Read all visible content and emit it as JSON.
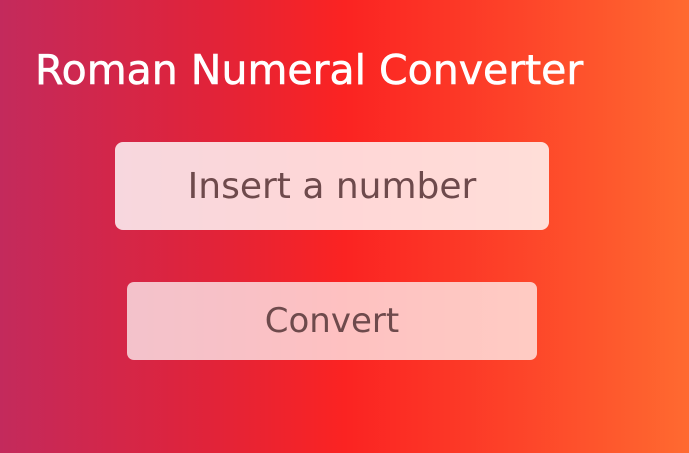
{
  "app": {
    "title": "Roman Numeral Converter"
  },
  "form": {
    "number_input": {
      "placeholder": "Insert a number",
      "value": ""
    },
    "convert_button_label": "Convert"
  },
  "colors": {
    "gradient_left": "#c32a5c",
    "gradient_middle": "#fb2322",
    "gradient_right": "#ff6a30",
    "title_text": "#ffffff",
    "control_text": "#6e4a4c"
  }
}
